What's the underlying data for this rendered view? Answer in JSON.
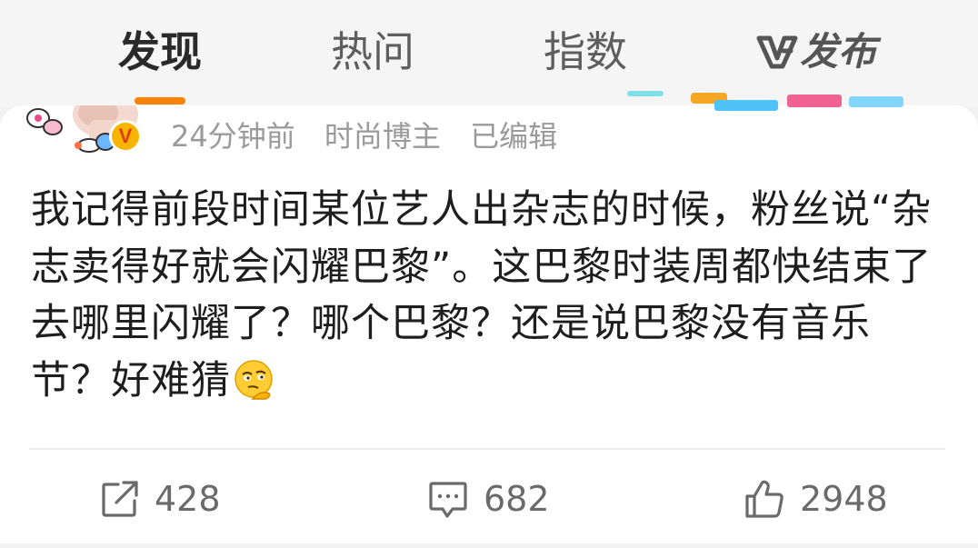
{
  "topnav": {
    "tabs": [
      "发现",
      "热问",
      "指数"
    ],
    "active_tab": "发现",
    "publish_label": "发布",
    "accent_color": "#ff8200"
  },
  "post": {
    "meta": {
      "time": "24分钟前",
      "author_tag": "时尚博主",
      "edited": "已编辑"
    },
    "verified_badge": "V",
    "text": "我记得前段时间某位艺人出杂志的时候，粉丝说“杂志卖得好就会闪耀巴黎”。这巴黎时装周都快结束了去哪里闪耀了？哪个巴黎？还是说巴黎没有音乐节？好难猜",
    "emoji": "thinking-face-emoji"
  },
  "actions": {
    "repost": {
      "icon": "share-icon",
      "count": "428"
    },
    "comment": {
      "icon": "comment-icon",
      "count": "682"
    },
    "like": {
      "icon": "thumbs-up-icon",
      "count": "2948"
    }
  }
}
